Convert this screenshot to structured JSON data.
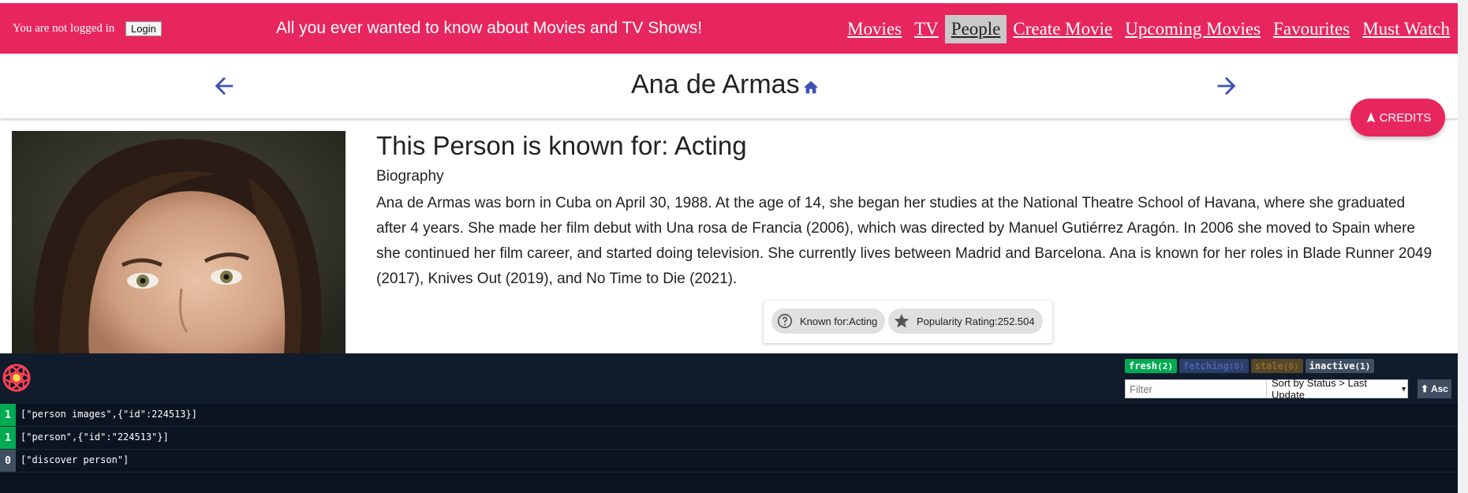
{
  "topbar": {
    "login_status": "You are not logged in",
    "login_button": "Login",
    "tagline": "All you ever wanted to know about Movies and TV Shows!",
    "nav": [
      "Movies",
      "TV",
      "People",
      "Create Movie",
      "Upcoming Movies",
      "Favourites",
      "Must Watch"
    ],
    "active_nav": "People",
    "accent_color": "#e8265e"
  },
  "person": {
    "name": "Ana de Armas",
    "known_for_heading": "This Person is known for: Acting",
    "biography_label": "Biography",
    "biography": "Ana de Armas was born in Cuba on April 30, 1988. At the age of 14, she began her studies at the National Theatre School of Havana, where she graduated after 4 years. She made her film debut with Una rosa de Francia (2006), which was directed by Manuel Gutiérrez Aragón. In 2006 she moved to Spain where she continued her film career, and started doing television. She currently lives between Madrid and Barcelona. Ana is known for her roles in Blade Runner 2049 (2017), Knives Out (2019), and No Time to Die (2021).",
    "chips": {
      "known_for": "Known for:Acting",
      "popularity": "Popularity Rating:252.504"
    },
    "credits_button": "CREDITS",
    "icons": {
      "prev": "arrow-left-icon",
      "next": "arrow-right-icon",
      "home": "home-icon",
      "credits": "navigation-icon",
      "known_for_chip": "help-circle-icon",
      "popularity_chip": "star-icon"
    }
  },
  "devtools": {
    "badges": [
      {
        "label": "fresh",
        "count": "(2)"
      },
      {
        "label": "fetching",
        "count": "(0)"
      },
      {
        "label": "stale",
        "count": "(0)"
      },
      {
        "label": "inactive",
        "count": "(1)"
      }
    ],
    "filter_placeholder": "Filter",
    "sort_label": "Sort by Status > Last Update",
    "asc_label": "⬆ Asc",
    "queries": [
      {
        "count": "1",
        "key": "[\"person images\",{\"id\":224513}]",
        "status": "fresh"
      },
      {
        "count": "1",
        "key": "[\"person\",{\"id\":\"224513\"}]",
        "status": "fresh"
      },
      {
        "count": "0",
        "key": "[\"discover person\"]",
        "status": "inactive"
      }
    ]
  }
}
